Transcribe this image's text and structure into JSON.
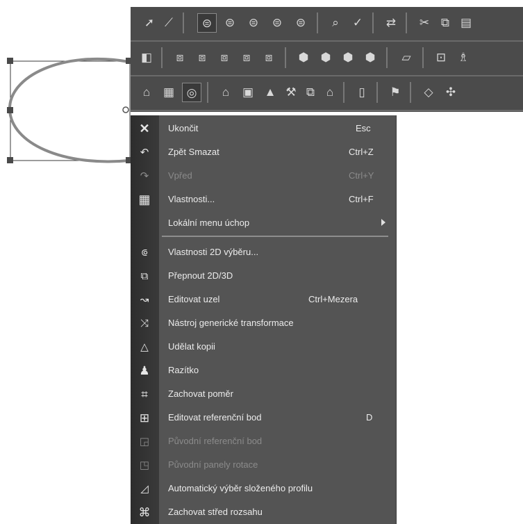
{
  "toolbars": {
    "row1": [
      "pointer-tool-icon",
      "node-tool-icon",
      "view-icon-1",
      "view-icon-2",
      "view-icon-3",
      "view-icon-4",
      "view-icon-5",
      "zoom-icon",
      "pick-icon",
      "transform-icon",
      "cut-icon",
      "copy-icon",
      "paste-icon"
    ],
    "row2": [
      "face-icon",
      "box-icon-1",
      "box-icon-2",
      "box-icon-3",
      "box-icon-4",
      "box-icon-5",
      "cube-icon-1",
      "cube-icon-2",
      "cube-icon-3",
      "cube-icon-4",
      "plane-icon",
      "snap-icon",
      "light-icon"
    ],
    "row3": [
      "open-folder-icon",
      "grid-icon",
      "target-icon",
      "folder-icon",
      "frame-icon",
      "cone-icon",
      "tools-icon",
      "duplicate-icon",
      "import-icon",
      "render-icon",
      "flag-icon",
      "shape-icon",
      "extra-icon"
    ]
  },
  "menu": {
    "items": [
      {
        "label": "Ukončit",
        "shortcut": "Esc",
        "icon": "close-icon",
        "enabled": true
      },
      {
        "label": "Zpět Smazat",
        "shortcut": "Ctrl+Z",
        "icon": "undo-icon",
        "enabled": true
      },
      {
        "label": "Vpřed",
        "shortcut": "Ctrl+Y",
        "icon": "redo-icon",
        "enabled": false
      },
      {
        "label": "Vlastnosti...",
        "shortcut": "Ctrl+F",
        "icon": "properties-icon",
        "enabled": true
      },
      {
        "label": "Lokální menu úchop",
        "shortcut": "",
        "icon": "",
        "enabled": true,
        "submenu": true
      },
      {
        "label": "Vlastnosti 2D výběru...",
        "shortcut": "",
        "icon": "selection-properties-icon",
        "enabled": true
      },
      {
        "label": "Přepnout 2D/3D",
        "shortcut": "",
        "icon": "toggle-2d3d-icon",
        "enabled": true
      },
      {
        "label": "Editovat uzel",
        "shortcut": "Ctrl+Mezera",
        "icon": "edit-node-icon",
        "enabled": true
      },
      {
        "label": "Nástroj generické transformace",
        "shortcut": "",
        "icon": "transform-tool-icon",
        "enabled": true
      },
      {
        "label": "Udělat kopii",
        "shortcut": "",
        "icon": "make-copy-icon",
        "enabled": true
      },
      {
        "label": "Razítko",
        "shortcut": "",
        "icon": "stamp-icon",
        "enabled": true
      },
      {
        "label": "Zachovat poměr",
        "shortcut": "",
        "icon": "keep-ratio-icon",
        "enabled": true
      },
      {
        "label": "Editovat referenční bod",
        "shortcut": "D",
        "icon": "edit-reference-point-icon",
        "enabled": true
      },
      {
        "label": "Původní referenční bod",
        "shortcut": "",
        "icon": "original-reference-point-icon",
        "enabled": false
      },
      {
        "label": "Původní panely rotace",
        "shortcut": "",
        "icon": "original-rotation-panels-icon",
        "enabled": false
      },
      {
        "label": "Automatický výběr složeného profilu",
        "shortcut": "",
        "icon": "auto-profile-select-icon",
        "enabled": true
      },
      {
        "label": "Zachovat střed rozsahu",
        "shortcut": "",
        "icon": "keep-extent-center-icon",
        "enabled": true
      }
    ]
  }
}
